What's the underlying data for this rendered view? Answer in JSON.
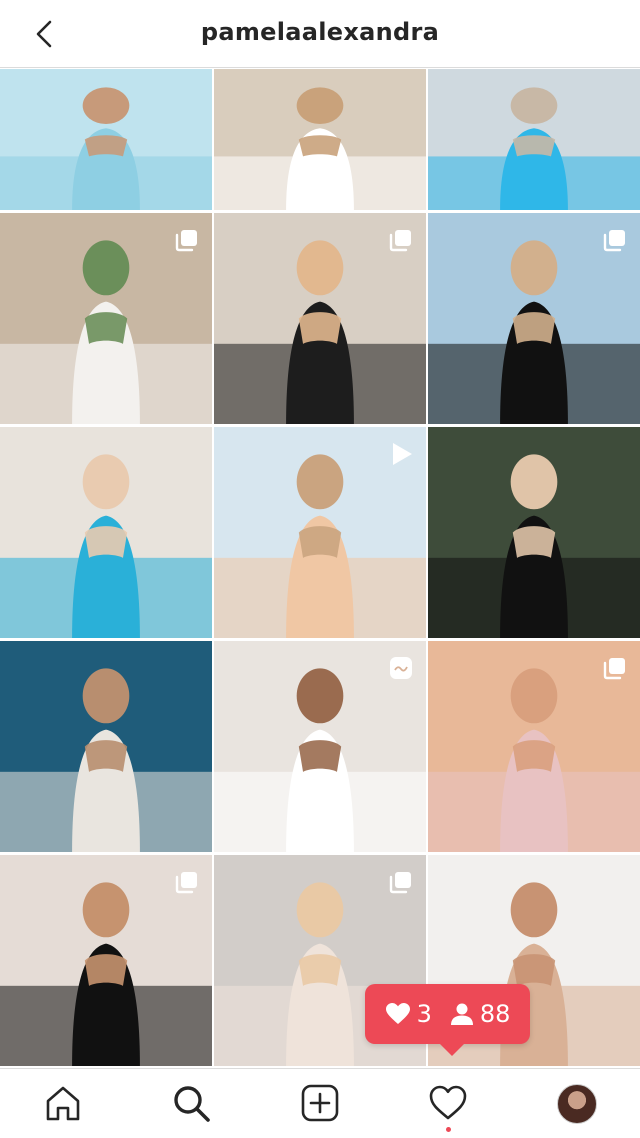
{
  "header": {
    "username": "pamelaalexandra",
    "back_icon": "chevron-left-icon"
  },
  "grid": {
    "tiles": [
      {
        "label": "post-1",
        "palette": [
          "#bfe3ee",
          "#8ecfe3",
          "#c79a7a"
        ],
        "badge": ""
      },
      {
        "label": "post-2",
        "palette": [
          "#d9cdbd",
          "#ffffff",
          "#c9a27b"
        ],
        "badge": ""
      },
      {
        "label": "post-3",
        "palette": [
          "#cfd9df",
          "#2fb7e8",
          "#c8b8a6"
        ],
        "badge": ""
      },
      {
        "label": "post-4",
        "palette": [
          "#c8b7a3",
          "#f3f1ee",
          "#6b8f5a"
        ],
        "badge": "carousel-icon"
      },
      {
        "label": "post-5",
        "palette": [
          "#d8cfc4",
          "#1d1d1d",
          "#e2b88f"
        ],
        "badge": "carousel-icon"
      },
      {
        "label": "post-6",
        "palette": [
          "#a9c9de",
          "#111111",
          "#d2b08d"
        ],
        "badge": "carousel-icon"
      },
      {
        "label": "post-7",
        "palette": [
          "#e8e3dc",
          "#2ab0d8",
          "#e9cbb0"
        ],
        "badge": ""
      },
      {
        "label": "post-8",
        "palette": [
          "#d7e6ef",
          "#f0c7a4",
          "#caa480"
        ],
        "badge": "video-icon"
      },
      {
        "label": "post-9",
        "palette": [
          "#3e4c3a",
          "#111111",
          "#e0c4a8"
        ],
        "badge": ""
      },
      {
        "label": "post-10",
        "palette": [
          "#1f5c7a",
          "#e9e5df",
          "#b88e6f"
        ],
        "badge": ""
      },
      {
        "label": "post-11",
        "palette": [
          "#e9e4df",
          "#ffffff",
          "#9a6b4f"
        ],
        "badge": "reel-icon"
      },
      {
        "label": "post-12",
        "palette": [
          "#e8b898",
          "#e8c2c2",
          "#d9a07e"
        ],
        "badge": "carousel-icon"
      },
      {
        "label": "post-13",
        "palette": [
          "#e5dcd6",
          "#111111",
          "#c6936f"
        ],
        "badge": "carousel-icon"
      },
      {
        "label": "post-14",
        "palette": [
          "#d2cdc9",
          "#efe3da",
          "#e9c9a5"
        ],
        "badge": "carousel-icon"
      },
      {
        "label": "post-15",
        "palette": [
          "#f2f0ee",
          "#d9b196",
          "#c89373"
        ],
        "badge": ""
      }
    ]
  },
  "activity_popup": {
    "likes": "3",
    "followers": "88",
    "color": "#ed4956"
  },
  "nav": {
    "items": [
      {
        "name": "home-icon"
      },
      {
        "name": "search-icon"
      },
      {
        "name": "new-post-icon"
      },
      {
        "name": "activity-heart-icon"
      },
      {
        "name": "profile-avatar"
      }
    ]
  }
}
